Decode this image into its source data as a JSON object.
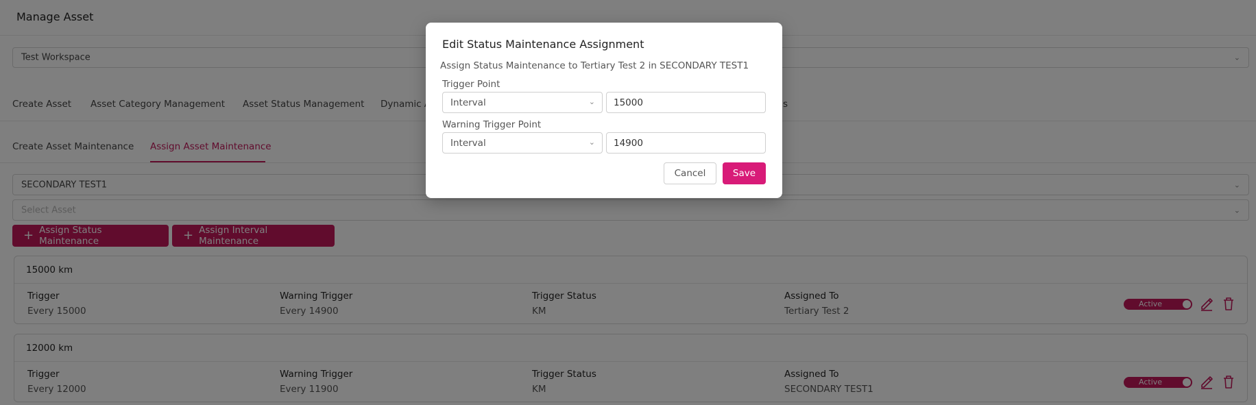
{
  "page": {
    "title": "Manage Asset"
  },
  "workspace": {
    "selected": "Test Workspace"
  },
  "main_tabs": [
    {
      "label": "Create Asset"
    },
    {
      "label": "Asset Category Management"
    },
    {
      "label": "Asset Status Management"
    },
    {
      "label": "Dynamic A"
    },
    {
      "label": "s"
    }
  ],
  "sub_tabs": [
    {
      "label": "Create Asset Maintenance"
    },
    {
      "label": "Assign Asset Maintenance"
    }
  ],
  "filters": {
    "category_selected": "SECONDARY TEST1",
    "asset_placeholder": "Select Asset"
  },
  "actions": {
    "assign_status": "Assign Status Maintenance",
    "assign_interval": "Assign Interval Maintenance"
  },
  "cards": [
    {
      "title": "15000 km",
      "cols": [
        {
          "label": "Trigger",
          "value": "Every 15000"
        },
        {
          "label": "Warning Trigger",
          "value": "Every 14900"
        },
        {
          "label": "Trigger Status",
          "value": "KM"
        },
        {
          "label": "Assigned To",
          "value": "Tertiary Test 2"
        }
      ],
      "status": "Active"
    },
    {
      "title": "12000 km",
      "cols": [
        {
          "label": "Trigger",
          "value": "Every 12000"
        },
        {
          "label": "Warning Trigger",
          "value": "Every 11900"
        },
        {
          "label": "Trigger Status",
          "value": "KM"
        },
        {
          "label": "Assigned To",
          "value": "SECONDARY TEST1"
        }
      ],
      "status": "Active"
    }
  ],
  "modal": {
    "title": "Edit Status Maintenance Assignment",
    "subtitle": "Assign Status Maintenance to Tertiary Test 2 in SECONDARY TEST1",
    "trigger_label": "Trigger Point",
    "trigger_type": "Interval",
    "trigger_value": "15000",
    "warning_label": "Warning Trigger Point",
    "warning_type": "Interval",
    "warning_value": "14900",
    "cancel": "Cancel",
    "save": "Save"
  },
  "colors": {
    "accent": "#c2185b",
    "save": "#d81b78"
  },
  "icons": {
    "edit": "pencil-icon",
    "delete": "trash-icon",
    "add": "plus-icon",
    "dropdown": "chevron-down-icon"
  }
}
